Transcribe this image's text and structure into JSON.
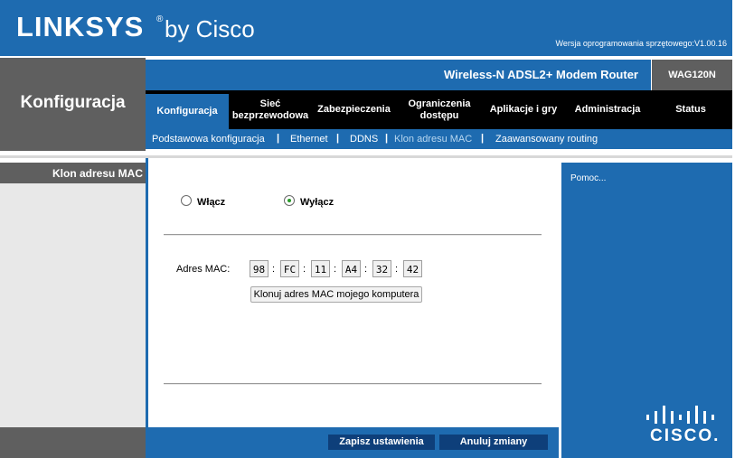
{
  "header": {
    "logo_main": "LINKSYS",
    "logo_reg": "®",
    "logo_sub": "by Cisco",
    "firmware": "Wersja oprogramowania sprzętowego:V1.00.16"
  },
  "section_title": "Konfiguracja",
  "product": {
    "name": "Wireless-N ADSL2+ Modem Router",
    "model": "WAG120N"
  },
  "tabs": [
    {
      "label": "Konfiguracja"
    },
    {
      "label": "Sieć bezprzewodowa"
    },
    {
      "label": "Zabezpieczenia"
    },
    {
      "label": "Ograniczenia dostępu"
    },
    {
      "label": "Aplikacje i gry"
    },
    {
      "label": "Administracja"
    },
    {
      "label": "Status"
    }
  ],
  "subnav": [
    {
      "label": "Podstawowa konfiguracja"
    },
    {
      "label": "Ethernet"
    },
    {
      "label": "DDNS"
    },
    {
      "label": "Klon adresu MAC"
    },
    {
      "label": "Zaawansowany routing"
    }
  ],
  "subnav_separator": "|",
  "left_label": "Klon adresu MAC",
  "form": {
    "enable_label": "Włącz",
    "disable_label": "Wyłącz",
    "selected": "Wyłącz",
    "mac_label": "Adres MAC:",
    "mac_octets": [
      "98",
      "FC",
      "11",
      "A4",
      "32",
      "42"
    ],
    "mac_separator": ":",
    "clone_button": "Klonuj adres MAC mojego komputera"
  },
  "buttons": {
    "save": "Zapisz ustawienia",
    "cancel": "Anuluj zmiany"
  },
  "help": {
    "link": "Pomoc..."
  },
  "brand": {
    "cisco": "CISCO."
  },
  "colors": {
    "brand_blue": "#1e6bb0",
    "dark_gray": "#5f5f5f",
    "nav_black": "#000000",
    "button_navy": "#0e3f7a"
  }
}
